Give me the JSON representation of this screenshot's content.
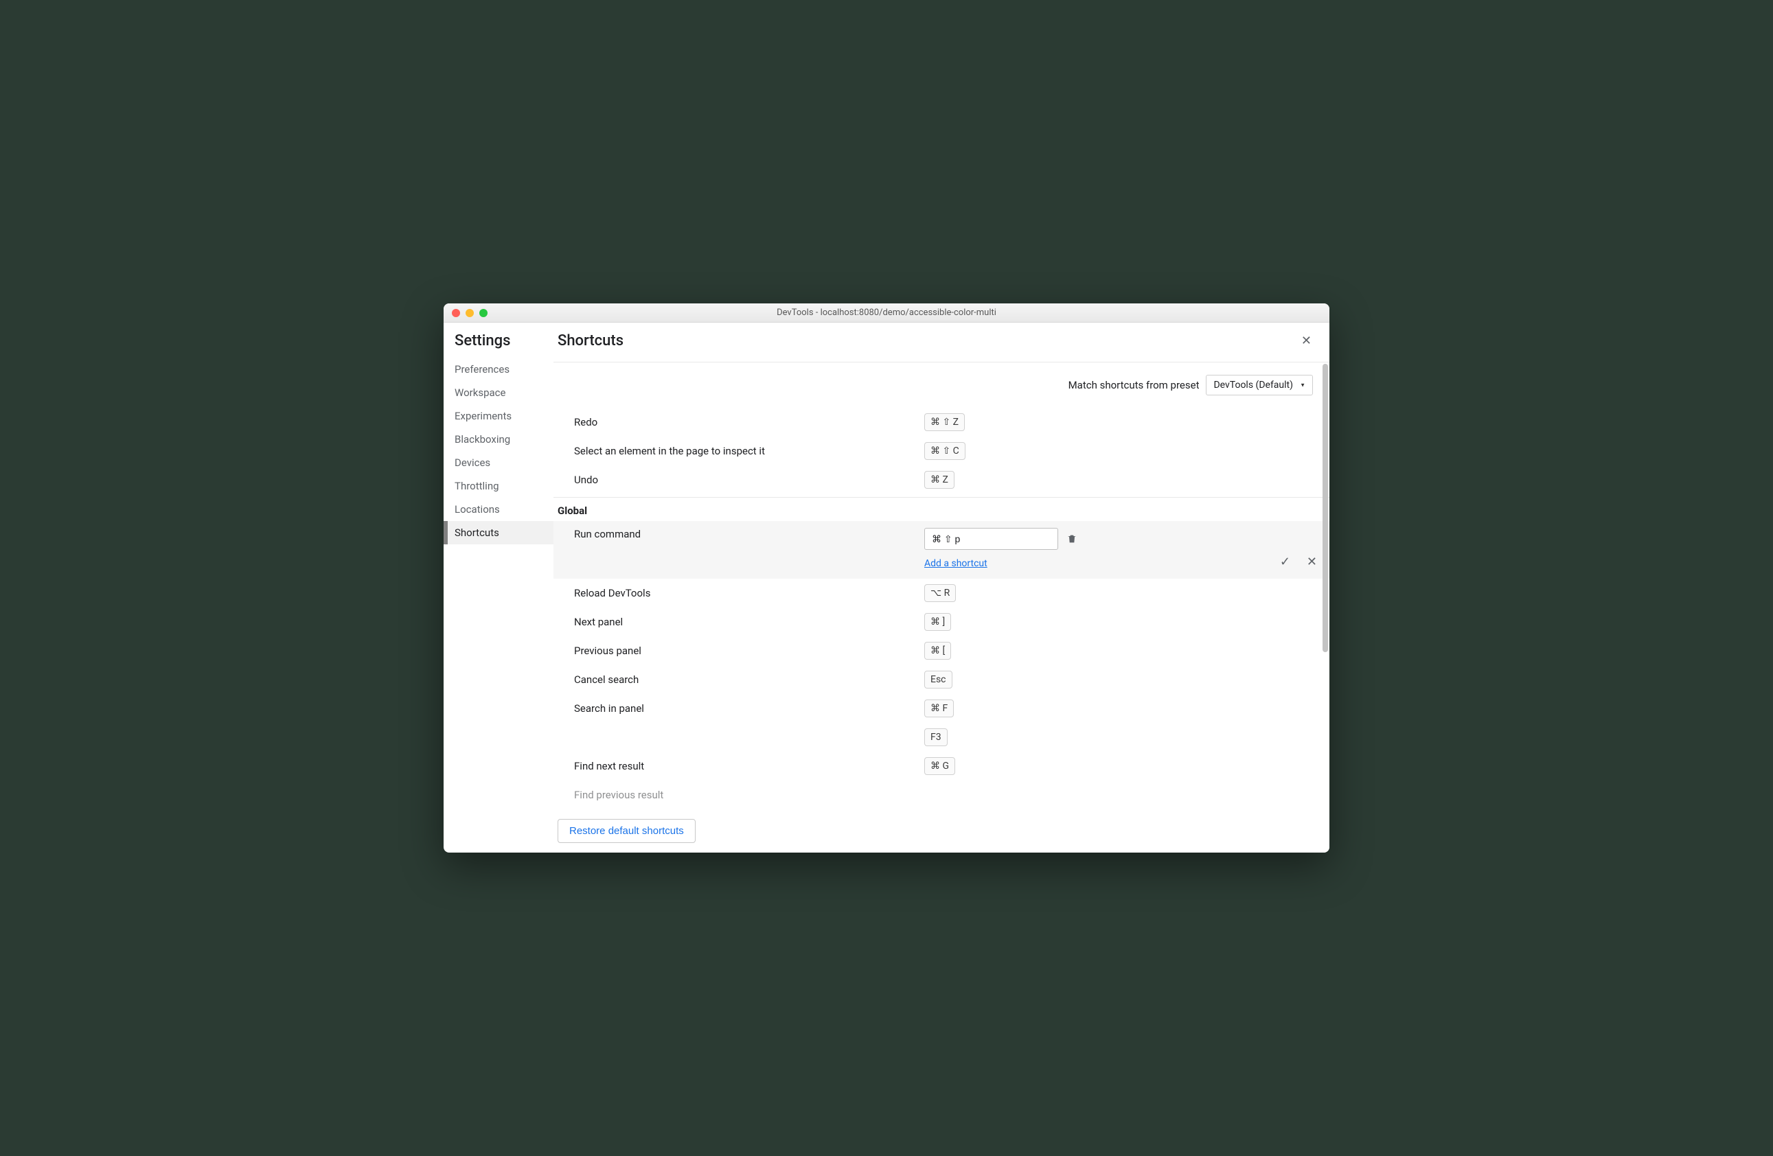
{
  "window": {
    "title": "DevTools - localhost:8080/demo/accessible-color-multi"
  },
  "sidebar": {
    "heading": "Settings",
    "items": [
      {
        "label": "Preferences"
      },
      {
        "label": "Workspace"
      },
      {
        "label": "Experiments"
      },
      {
        "label": "Blackboxing"
      },
      {
        "label": "Devices"
      },
      {
        "label": "Throttling"
      },
      {
        "label": "Locations"
      },
      {
        "label": "Shortcuts",
        "selected": true
      }
    ]
  },
  "main": {
    "title": "Shortcuts",
    "preset_label": "Match shortcuts from preset",
    "preset_value": "DevTools (Default)",
    "pre_rows": [
      {
        "label": "Redo",
        "keys": "⌘ ⇧ Z"
      },
      {
        "label": "Select an element in the page to inspect it",
        "keys": "⌘ ⇧ C"
      },
      {
        "label": "Undo",
        "keys": "⌘ Z"
      }
    ],
    "section": "Global",
    "editing": {
      "label": "Run command",
      "value": "⌘ ⇧ p",
      "add_link": "Add a shortcut"
    },
    "post_rows": [
      {
        "label": "Reload DevTools",
        "keys": "⌥ R"
      },
      {
        "label": "Next panel",
        "keys": "⌘ ]"
      },
      {
        "label": "Previous panel",
        "keys": "⌘ ["
      },
      {
        "label": "Cancel search",
        "keys": "Esc"
      },
      {
        "label": "Search in panel",
        "keys": "⌘ F"
      },
      {
        "label": "",
        "keys": "F3"
      },
      {
        "label": "Find next result",
        "keys": "⌘ G"
      },
      {
        "label": "Find previous result",
        "keys": ""
      }
    ],
    "restore_label": "Restore default shortcuts"
  }
}
